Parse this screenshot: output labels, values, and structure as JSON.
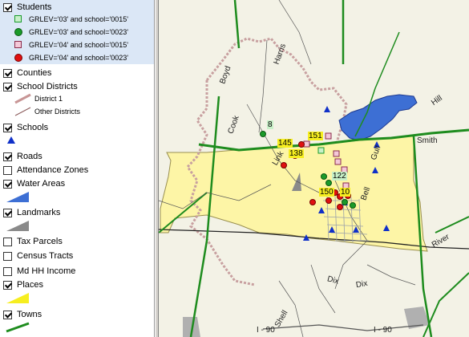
{
  "legend": {
    "students": {
      "label": "Students",
      "checked": true,
      "entries": [
        {
          "label": "GRLEV='03' and school='0015'",
          "color": "#c8f0c8"
        },
        {
          "label": "GRLEV='03' and school='0023'",
          "color": "#1a9a2a"
        },
        {
          "label": "GRLEV='04' and school='0015'",
          "color": "#f4c8d8"
        },
        {
          "label": "GRLEV='04' and school='0023'",
          "color": "#e01010"
        }
      ]
    },
    "counties": {
      "label": "Counties",
      "checked": true
    },
    "school_districts": {
      "label": "School Districts",
      "checked": true,
      "district1": "District 1",
      "other": "Other Districts"
    },
    "schools": {
      "label": "Schools",
      "checked": true
    },
    "roads": {
      "label": "Roads",
      "checked": true
    },
    "attendance_zones": {
      "label": "Attendance Zones",
      "checked": false
    },
    "water_areas": {
      "label": "Water Areas",
      "checked": true
    },
    "landmarks": {
      "label": "Landmarks",
      "checked": true
    },
    "tax_parcels": {
      "label": "Tax Parcels",
      "checked": false
    },
    "census_tracts": {
      "label": "Census Tracts",
      "checked": false
    },
    "md_hh_income": {
      "label": "Md HH Income",
      "checked": false
    },
    "places": {
      "label": "Places",
      "checked": true
    },
    "towns": {
      "label": "Towns",
      "checked": true
    }
  },
  "map": {
    "roads": [
      "Boyd",
      "Harris",
      "Hill",
      "Cook",
      "Smith",
      "Gulf",
      "Link",
      "Bell",
      "River",
      "Dix",
      "Dix",
      "Shell",
      "I - 90",
      "I - 90"
    ],
    "student_counts": [
      "8",
      "151",
      "145",
      "138",
      "122",
      "150",
      "10"
    ],
    "colors": {
      "places": "#fdf5a6",
      "water": "#3d6fd4",
      "roads": "#1e8c1e",
      "district": "#c8a0a0"
    }
  }
}
